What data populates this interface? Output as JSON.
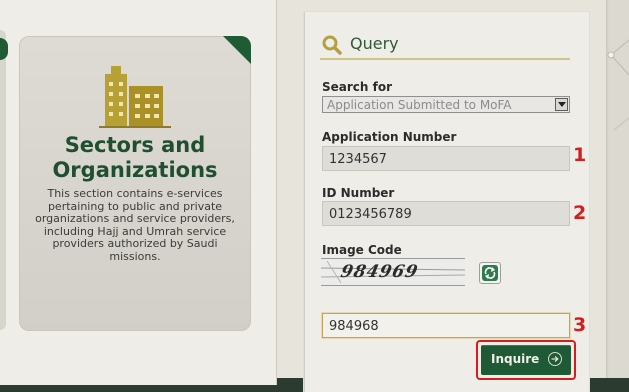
{
  "sector_card": {
    "title": "Sectors and Organizations",
    "description": "This section contains e-services pertaining to public and private organizations and service providers, including Hajj and Umrah service providers authorized by Saudi missions.",
    "icon": "buildings-icon"
  },
  "query": {
    "title": "Query",
    "title_icon": "search-icon",
    "search_for": {
      "label": "Search for",
      "value": "Application Submitted to MoFA"
    },
    "application_number": {
      "label": "Application Number",
      "value": "1234567",
      "step": "1"
    },
    "id_number": {
      "label": "ID Number",
      "value": "0123456789",
      "step": "2"
    },
    "image_code": {
      "label": "Image Code",
      "captcha_text": "984969",
      "input_value": "984968",
      "step": "3"
    },
    "inquire_label": "Inquire"
  },
  "colors": {
    "brand_green": "#1f5a36",
    "accent_gold": "#cfc48a",
    "step_red": "#d11f1f"
  }
}
